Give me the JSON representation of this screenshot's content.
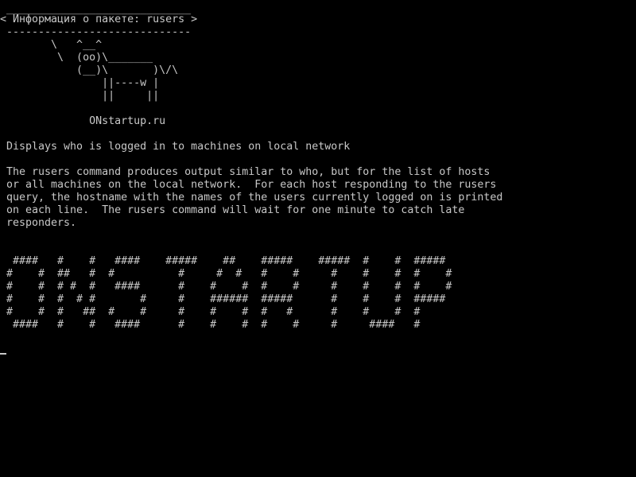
{
  "terminal": {
    "cow": {
      "border_top": "_____________________________",
      "title": "< Информация о пакете: rusers >",
      "border_bottom": " -----------------------------",
      "art_1": "       \\   ^__^",
      "art_2": "        \\  (oo)\\_______",
      "art_3": "           (__)\\       )\\/\\",
      "art_4": "               ||----w |",
      "art_5": "               ||     ||"
    },
    "site": "             ONstartup.ru",
    "summary": "Displays who is logged in to machines on local network",
    "description": [
      "The rusers command produces output similar to who, but for the list of hosts",
      "or all machines on the local network.  For each host responding to the rusers",
      "query, the hostname with the names of the users currently logged on is printed",
      "on each line.  The rusers command will wait for one minute to catch late",
      "responders."
    ],
    "banner": [
      " ####   #    #   ####    #####    ##    #####    #####  #    #  #####",
      "#    #  ##   #  #          #     #  #   #    #     #    #    #  #    #",
      "#    #  # #  #   ####      #    #    #  #    #     #    #    #  #    #",
      "#    #  #  # #       #     #    ######  #####      #    #    #  #####",
      "#    #  #   ##  #    #     #    #    #  #   #      #    #    #  #",
      " ####   #    #   ####      #    #    #  #    #     #     ####   #"
    ]
  }
}
